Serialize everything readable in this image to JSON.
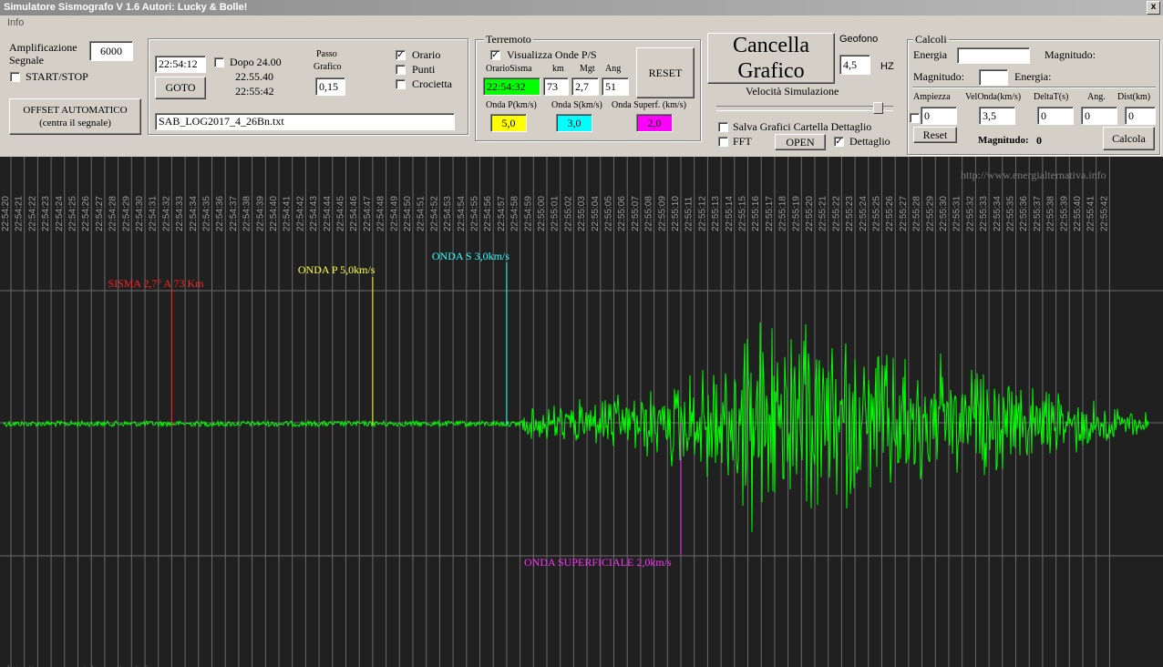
{
  "window": {
    "title": "Simulatore Sismografo V 1.6  Autori: Lucky & Bolle!",
    "close": "x"
  },
  "menu": {
    "info": "Info"
  },
  "amplification": {
    "label_line1": "Amplificazione",
    "label_line2": "Segnale",
    "value": "6000",
    "start_stop": "START/STOP",
    "offset_line1": "OFFSET AUTOMATICO",
    "offset_line2": "(centra il segnale)"
  },
  "goto_panel": {
    "time": "22:54:12",
    "dopo": "Dopo 24.00",
    "goto": "GOTO",
    "time1": "22.55.40",
    "time2": "22:55:42",
    "passo1": "Passo",
    "passo2": "Grafico",
    "passo_value": "0,15",
    "orario": "Orario",
    "punti": "Punti",
    "crocietta": "Crocietta",
    "orario_checked": true,
    "filename": "SAB_LOG2017_4_26Bn.txt"
  },
  "terremoto": {
    "title": "Terremoto",
    "visualizza": "Visualizza Onde P/S",
    "visualizza_checked": true,
    "h_orario": "OrarioSisma",
    "h_km": "km",
    "h_mgt": "Mgt",
    "h_ang": "Ang",
    "orario": "22:54:32",
    "km": "73",
    "mgt": "2,7",
    "ang": "51",
    "reset": "RESET",
    "h_p": "Onda P(km/s)",
    "h_s": "Onda S(km/s)",
    "h_sup": "Onda Superf. (km/s)",
    "p_value": "5,0",
    "s_value": "3,0",
    "sup_value": "2,0",
    "colors": {
      "orario": "#00ff00",
      "p": "#ffff00",
      "s": "#00ffff",
      "sup": "#ff00ff"
    }
  },
  "controls": {
    "cancella1": "Cancella",
    "cancella2": "Grafico",
    "geofono": "Geofono",
    "geofono_value": "4,5",
    "hz": "HZ",
    "velocita": "Velocità Simulazione",
    "slider_position": 0.93,
    "salva": "Salva Grafici Cartella Dettaglio",
    "fft": "FFT",
    "open": "OPEN",
    "dettaglio": "Dettaglio",
    "dettaglio_checked": true
  },
  "calcoli": {
    "title": "Calcoli",
    "energia": "Energia",
    "magnitudo_right": "Magnitudo:",
    "magnitudo": "Magnitudo:",
    "energia2": "Energia:",
    "h_ampiezza": "Ampiezza",
    "h_velonda": "VelOnda(km/s)",
    "h_deltat": "DeltaT(s)",
    "h_ang": "Ang.",
    "h_dist": "Dist(km)",
    "ampiezza": "0",
    "velonda": "3,5",
    "deltat": "0",
    "ang": "0",
    "dist": "0",
    "reset": "Reset",
    "magnitudo_result_label": "Magnitudo:",
    "magnitudo_result": "0",
    "calcola": "Calcola"
  },
  "seismograph": {
    "watermark": "http://www.energialternativa.info",
    "watermark_bottom": "http://www.energialternativa.info",
    "time_labels": [
      "22:54:20",
      "22:54:21",
      "22:54:22",
      "22:54:23",
      "22:54:24",
      "22:54:25",
      "22:54:26",
      "22:54:27",
      "22:54:28",
      "22:54:29",
      "22:54:30",
      "22:54:31",
      "22:54:32",
      "22:54:33",
      "22:54:34",
      "22:54:35",
      "22:54:36",
      "22:54:37",
      "22:54:38",
      "22:54:39",
      "22:54:40",
      "22:54:41",
      "22:54:42",
      "22:54:43",
      "22:54:44",
      "22:54:45",
      "22:54:46",
      "22:54:47",
      "22:54:48",
      "22:54:49",
      "22:54:50",
      "22:54:51",
      "22:54:52",
      "22:54:53",
      "22:54:54",
      "22:54:55",
      "22:54:56",
      "22:54:57",
      "22:54:58",
      "22:54:59",
      "22:55:00",
      "22:55:01",
      "22:55:02",
      "22:55:03",
      "22:55:04",
      "22:55:05",
      "22:55:06",
      "22:55:07",
      "22:55:08",
      "22:55:09",
      "22:55:10",
      "22:55:11",
      "22:55:12",
      "22:55:13",
      "22:55:14",
      "22:55:15",
      "22:55:16",
      "22:55:17",
      "22:55:18",
      "22:55:19",
      "22:55:20",
      "22:55:21",
      "22:55:22",
      "22:55:23",
      "22:55:24",
      "22:55:25",
      "22:55:26",
      "22:55:27",
      "22:55:28",
      "22:55:29",
      "22:55:30",
      "22:55:31",
      "22:55:32",
      "22:55:33",
      "22:55:34",
      "22:55:35",
      "22:55:36",
      "22:55:37",
      "22:55:38",
      "22:55:39",
      "22:55:40",
      "22:55:41",
      "22:55:42"
    ],
    "markers": [
      {
        "label": "SISMA 2,7° A 73 Km",
        "time": "22:54:32",
        "color": "#ff2020"
      },
      {
        "label": "ONDA P 5,0km/s",
        "time": "22:54:47",
        "color": "#ffff40"
      },
      {
        "label": "ONDA S 3,0km/s",
        "time": "22:54:57",
        "color": "#30ffff"
      },
      {
        "label": "ONDA SUPERFICIALE 2,0km/s",
        "time": "22:55:10",
        "color": "#ff30ff"
      }
    ],
    "trace_color": "#00ff00"
  }
}
